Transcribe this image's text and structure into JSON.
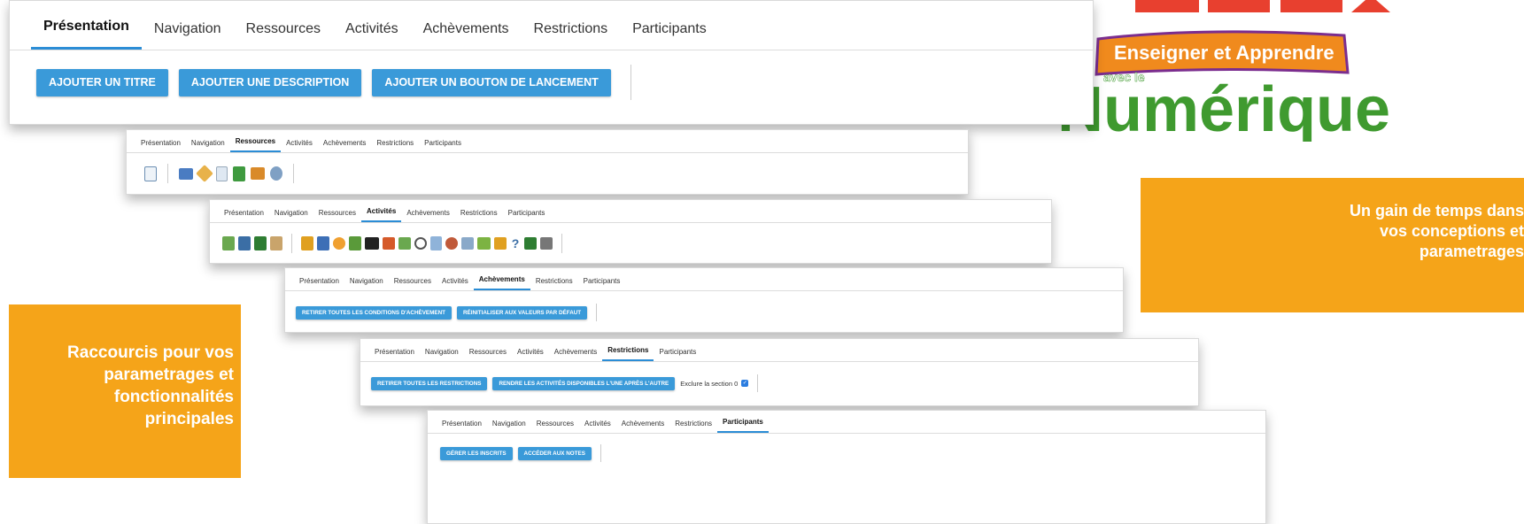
{
  "tabs": [
    "Présentation",
    "Navigation",
    "Ressources",
    "Activités",
    "Achèvements",
    "Restrictions",
    "Participants"
  ],
  "panel_presentation": {
    "active_tab": "Présentation",
    "buttons": [
      "AJOUTER UN TITRE",
      "AJOUTER UNE DESCRIPTION",
      "AJOUTER UN BOUTON DE LANCEMENT"
    ]
  },
  "panel_ressources": {
    "active_tab": "Ressources",
    "icons": [
      "page-icon",
      "folder-icon",
      "url-icon",
      "file-icon",
      "book-icon",
      "imscp-icon",
      "label-icon"
    ]
  },
  "panel_activites": {
    "active_tab": "Activités",
    "icons": [
      "glossary-icon",
      "database-icon",
      "workshop-icon",
      "lesson-icon",
      "choice-icon",
      "feedback-icon",
      "chat-icon",
      "assignment-icon",
      "h5p-icon",
      "forum-icon",
      "survey-icon",
      "quiz-icon",
      "wiki-icon",
      "scorm-icon",
      "lti-icon",
      "puzzle-icon",
      "badge-icon",
      "question-icon",
      "checklist-icon",
      "grid-icon"
    ]
  },
  "panel_achevements": {
    "active_tab": "Achèvements",
    "buttons": [
      "RETIRER TOUTES LES CONDITIONS D'ACHÈVEMENT",
      "RÉINITIALISER AUX VALEURS PAR DÉFAUT"
    ]
  },
  "panel_restrictions": {
    "active_tab": "Restrictions",
    "buttons": [
      "RETIRER TOUTES LES RESTRICTIONS",
      "RENDRE LES ACTIVITÉS DISPONIBLES L'UNE APRÈS L'AUTRE"
    ],
    "exclude_label": "Exclure la section 0",
    "exclude_checked": true
  },
  "panel_participants": {
    "active_tab": "Participants",
    "buttons": [
      "GÉRER LES INSCRITS",
      "ACCÉDER AUX NOTES"
    ]
  },
  "callout_right": [
    "Un gain de temps dans",
    "vos conceptions et",
    "parametrages"
  ],
  "callout_left": [
    "Raccourcis pour vos",
    "parametrages et",
    "fonctionnalités",
    "principales"
  ],
  "logo": {
    "banner": "Enseigner et Apprendre",
    "sub": "avec le",
    "word": "Numérique"
  },
  "colors": {
    "accent": "#3a9ad9",
    "callout": "#f5a419",
    "logo_green": "#3f9a2f",
    "logo_orange": "#f08a1d"
  }
}
